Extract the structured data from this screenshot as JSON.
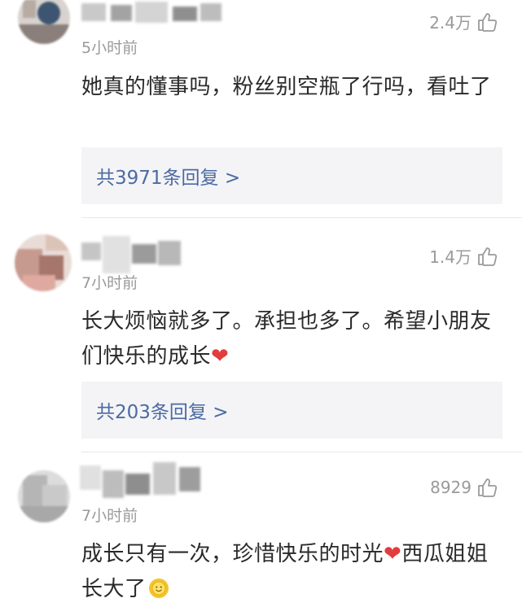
{
  "comments": [
    {
      "time": "5小时前",
      "likes": "2.4万",
      "text": "她真的懂事吗，粉丝别空瓶了行吗，看吐了",
      "replies": "共3971条回复 >"
    },
    {
      "time": "7小时前",
      "likes": "1.4万",
      "text_before": "长大烦恼就多了。承担也多了。希望小朋友们快乐的成长",
      "heart": "❤",
      "replies": "共203条回复 >"
    },
    {
      "time": "7小时前",
      "likes": "8929",
      "text_before": "成长只有一次，珍惜快乐的时光",
      "heart": "❤",
      "text_after": "西瓜姐姐长大了"
    }
  ],
  "icons": {
    "like": "thumbs-up-icon",
    "avatar": "avatar",
    "sun_emoji": "smiling-sun-icon"
  },
  "colors": {
    "reply_link": "#4c6aa3",
    "reply_bg": "#f4f4f6",
    "meta_text": "#9a9a9a",
    "heart": "#e23c3c"
  }
}
